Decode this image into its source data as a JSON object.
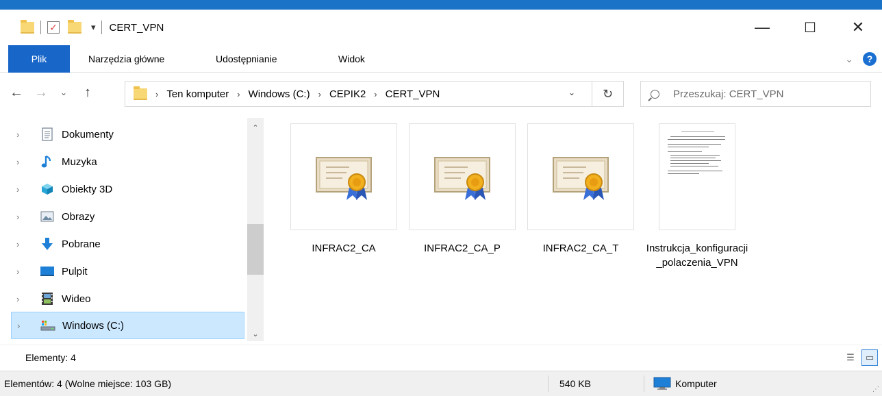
{
  "window": {
    "title": "CERT_VPN",
    "controls": {
      "minimize": "—",
      "maximize": "☐",
      "close": "✕"
    }
  },
  "ribbon": {
    "tabs": [
      "Plik",
      "Narzędzia główne",
      "Udostępnianie",
      "Widok"
    ]
  },
  "address": {
    "back": "←",
    "forward": "→",
    "recent": "⌄",
    "up": "↑",
    "crumbs": [
      "Ten komputer",
      "Windows (C:)",
      "CEPIK2",
      "CERT_VPN"
    ],
    "separator": "›",
    "dropdown": "⌄",
    "refresh": "↻",
    "search_placeholder": "Przeszukaj: CERT_VPN"
  },
  "nav_pane": {
    "expand_glyph": "›",
    "items": [
      {
        "label": "Dokumenty",
        "icon": "documents-icon"
      },
      {
        "label": "Muzyka",
        "icon": "music-icon"
      },
      {
        "label": "Obiekty 3D",
        "icon": "3d-objects-icon"
      },
      {
        "label": "Obrazy",
        "icon": "pictures-icon"
      },
      {
        "label": "Pobrane",
        "icon": "downloads-icon"
      },
      {
        "label": "Pulpit",
        "icon": "desktop-icon"
      },
      {
        "label": "Wideo",
        "icon": "videos-icon"
      },
      {
        "label": "Windows (C:)",
        "icon": "drive-icon",
        "selected": true
      }
    ],
    "scroll_up": "⌃",
    "scroll_down": "⌄"
  },
  "files": [
    {
      "name": "INFRAC2_CA",
      "type": "certificate"
    },
    {
      "name": "INFRAC2_CA_P",
      "type": "certificate"
    },
    {
      "name": "INFRAC2_CA_T",
      "type": "certificate"
    },
    {
      "name": "Instrukcja_konfiguracji_polaczenia_VPN",
      "type": "document"
    }
  ],
  "status": {
    "items_count": "Elementy: 4",
    "summary": "Elementów: 4 (Wolne miejsce: 103 GB)",
    "size": "540 KB",
    "location": "Komputer"
  },
  "colors": {
    "accent": "#1966c9",
    "selection": "#cce8ff",
    "folder": "#f8d775"
  }
}
